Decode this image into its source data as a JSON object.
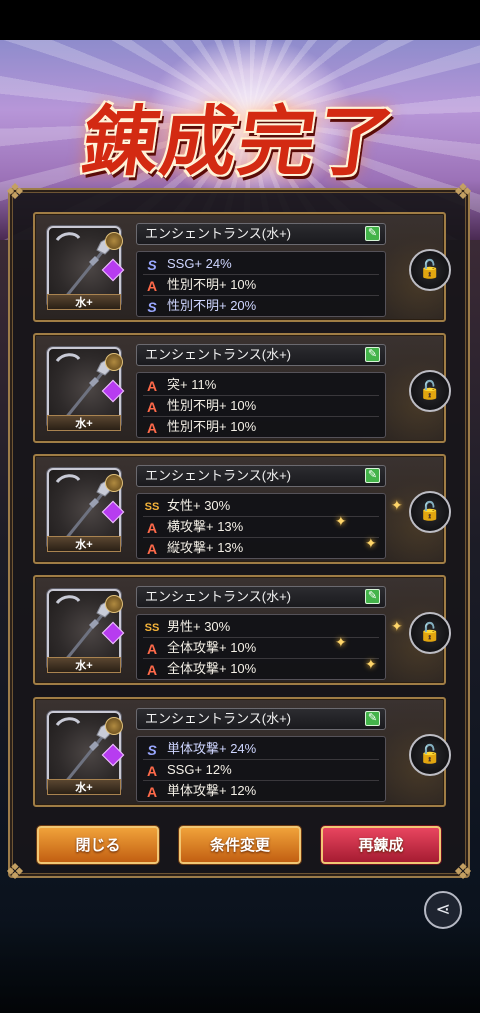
{
  "screen": {
    "title": "錬成完了"
  },
  "items": [
    {
      "name": "エンシェントランス(水+)",
      "thumb_label": "水+",
      "stats": [
        {
          "icon": "s-icon",
          "text": "SSG+ 24%"
        },
        {
          "icon": "a-icon",
          "text": "性別不明+ 10%"
        },
        {
          "icon": "s-icon",
          "text": "性別不明+ 20%"
        }
      ]
    },
    {
      "name": "エンシェントランス(水+)",
      "thumb_label": "水+",
      "stats": [
        {
          "icon": "a-icon",
          "text": "突+ 11%"
        },
        {
          "icon": "a-icon",
          "text": "性別不明+ 10%"
        },
        {
          "icon": "a-icon",
          "text": "性別不明+ 10%"
        }
      ]
    },
    {
      "name": "エンシェントランス(水+)",
      "thumb_label": "水+",
      "stats": [
        {
          "icon": "ss-icon",
          "text": "女性+ 30%"
        },
        {
          "icon": "a-icon",
          "text": "横攻撃+ 13%"
        },
        {
          "icon": "a-icon",
          "text": "縦攻撃+ 13%"
        }
      ]
    },
    {
      "name": "エンシェントランス(水+)",
      "thumb_label": "水+",
      "stats": [
        {
          "icon": "ss-icon",
          "text": "男性+ 30%"
        },
        {
          "icon": "a-icon",
          "text": "全体攻撃+ 10%"
        },
        {
          "icon": "a-icon",
          "text": "全体攻撃+ 10%"
        }
      ]
    },
    {
      "name": "エンシェントランス(水+)",
      "thumb_label": "水+",
      "stats": [
        {
          "icon": "s-icon",
          "text": "単体攻撃+ 24%"
        },
        {
          "icon": "a-icon",
          "text": "SSG+ 12%"
        },
        {
          "icon": "a-icon",
          "text": "単体攻撃+ 12%"
        }
      ]
    }
  ],
  "buttons": {
    "close": "閉じる",
    "change_conditions": "条件変更",
    "re_refine": "再錬成"
  },
  "colors": {
    "accent_gold": "#a07d45",
    "button_orange": "#d9801f",
    "button_red": "#c42c45",
    "edit_green": "#43b34a"
  }
}
